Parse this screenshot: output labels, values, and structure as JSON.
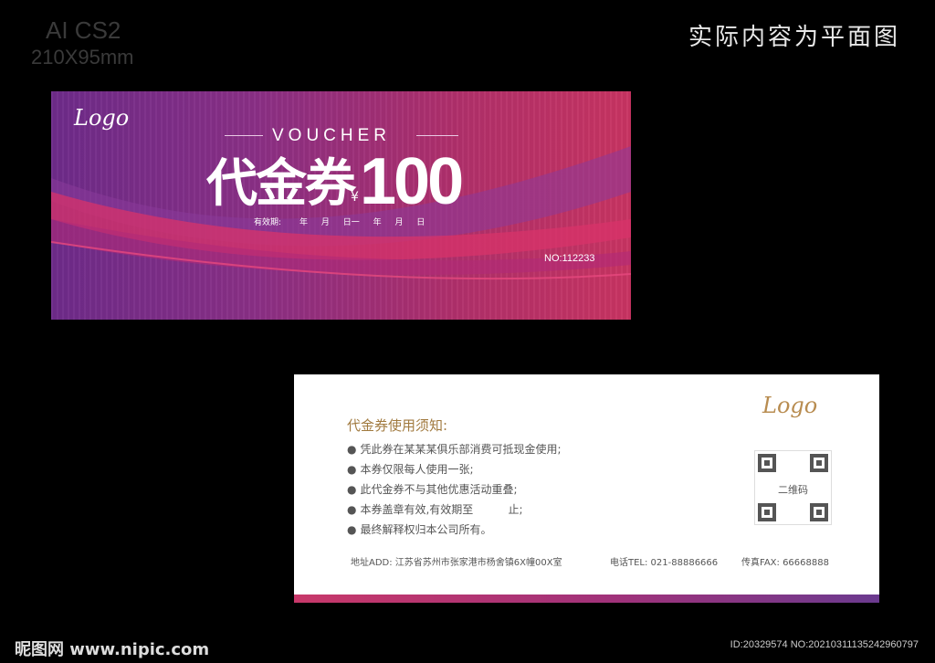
{
  "spec": {
    "title": "AI CS2",
    "size": "210X95mm"
  },
  "note": "实际内容为平面图",
  "front": {
    "logo": "Logo",
    "voucher_word": "VOUCHER",
    "title": "代金券",
    "currency": "¥",
    "amount": "100",
    "validity_label": "有效期:",
    "validity_dates": "年 月 日一 年 月 日",
    "serial": "NO:112233",
    "colors": {
      "left": "#6e2b8a",
      "right": "#c93462"
    }
  },
  "back": {
    "logo": "Logo",
    "rules_title": "代金券使用须知:",
    "bullet": "●",
    "rules": [
      "凭此券在某某某俱乐部消费可抵现金使用;",
      "本券仅限每人使用一张;",
      "此代金券不与其他优惠活动重叠;",
      "本券盖章有效,有效期至          止;",
      "最终解释权归本公司所有。"
    ],
    "qr_label": "二维码",
    "address": "地址ADD: 江苏省苏州市张家港市杨舍镇6X幢00X室",
    "phone": "电话TEL: 021-88886666",
    "fax": "传真FAX: 66668888",
    "accent_color": "#a17a3f"
  },
  "watermark": {
    "left": "昵图网 www.nipic.com",
    "right": "ID:20329574 NO:20210311135242960797"
  }
}
